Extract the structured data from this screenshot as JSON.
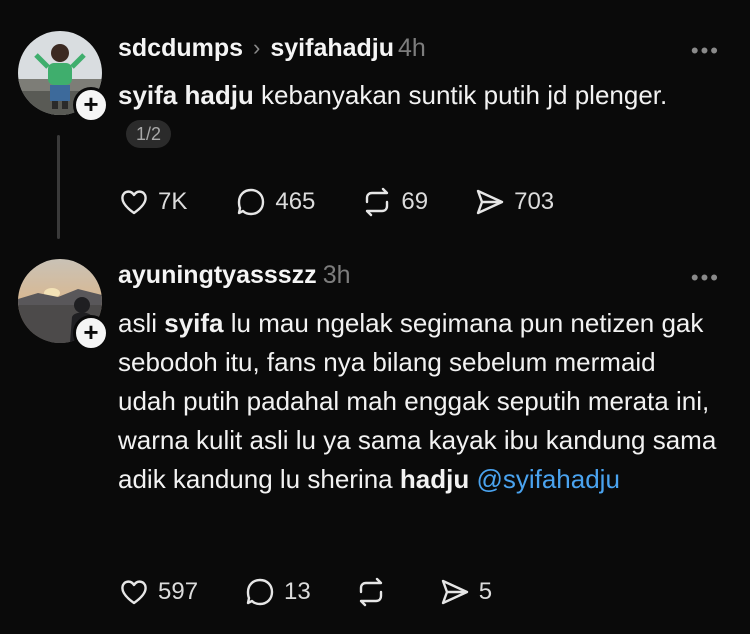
{
  "post1": {
    "author": "sdcdumps",
    "separator": "›",
    "reply_to": "syifahadju",
    "time": "4h",
    "more": "•••",
    "text_bold": "syifa hadju",
    "text_rest": " kebanyakan suntik putih jd plenger.",
    "page_indicator": "1/2",
    "likes": "7K",
    "comments": "465",
    "reposts": "69",
    "shares": "703"
  },
  "post2": {
    "author": "ayuningtyassszz",
    "time": "3h",
    "more": "•••",
    "text_parts": {
      "p1": "asli ",
      "b1": "syifa",
      "p2": " lu mau ngelak segimana pun netizen gak sebodoh itu, fans nya bilang sebelum mermaid udah putih padahal mah enggak seputih merata ini, warna kulit asli lu ya sama kayak ibu kandung sama adik kandung lu sherina ",
      "b2": "hadju",
      "p3": " ",
      "mention": "@syifahadju"
    },
    "likes": "597",
    "comments": "13",
    "reposts": "",
    "shares": "5"
  },
  "icons": {
    "like": "heart-icon",
    "comment": "comment-icon",
    "repost": "repost-icon",
    "share": "send-icon",
    "follow": "plus-icon"
  },
  "colors": {
    "background": "#0a0a0a",
    "mention": "#4aa3ef",
    "muted": "#7d7d7d"
  }
}
